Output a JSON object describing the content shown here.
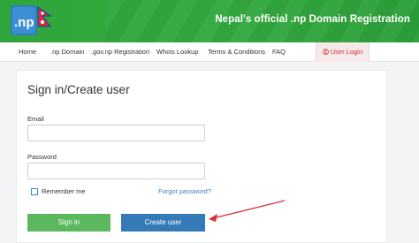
{
  "header": {
    "logo_text": ".np",
    "title": "Nepal's official .np Domain Registration"
  },
  "nav": {
    "items": [
      {
        "label": "Home"
      },
      {
        "label": ".np Domain"
      },
      {
        "label": ".gov.np Registration"
      },
      {
        "label": "Whois Lookup"
      },
      {
        "label": "Terms & Conditions"
      },
      {
        "label": "FAQ"
      }
    ],
    "login_label": "User Login"
  },
  "form": {
    "title": "Sign in/Create user",
    "email_label": "Email",
    "email_value": "",
    "password_label": "Password",
    "password_value": "",
    "remember_label": "Remember me",
    "remember_checked": false,
    "forgot_label": "Forgot password?",
    "signin_label": "Sign in",
    "create_label": "Create user"
  },
  "colors": {
    "header_green": "#34a940",
    "signin_green": "#5cb85c",
    "create_blue": "#337ab7",
    "login_red": "#c9302c",
    "annotation_arrow": "#d9303a"
  }
}
